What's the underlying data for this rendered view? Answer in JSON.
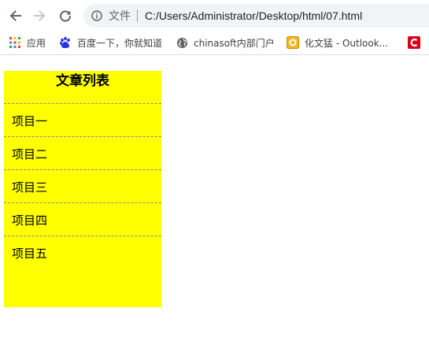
{
  "browser": {
    "omnibox": {
      "scheme_label": "文件",
      "url": "C:/Users/Administrator/Desktop/html/07.html"
    },
    "bookmarks": [
      {
        "label": "应用",
        "icon": "apps-grid-icon"
      },
      {
        "label": "百度一下，你就知道",
        "icon": "baidu-paw-icon"
      },
      {
        "label": "chinasoft内部门户",
        "icon": "globe-icon"
      },
      {
        "label": "化文猛 - Outlook...",
        "icon": "outlook-icon"
      },
      {
        "label": "",
        "icon": "red-c-icon"
      }
    ]
  },
  "page": {
    "title": "文章列表",
    "items": [
      "项目一",
      "项目二",
      "项目三",
      "项目四",
      "项目五"
    ],
    "colors": {
      "box_background": "#ffff00",
      "divider": "#8a8a8a"
    }
  }
}
